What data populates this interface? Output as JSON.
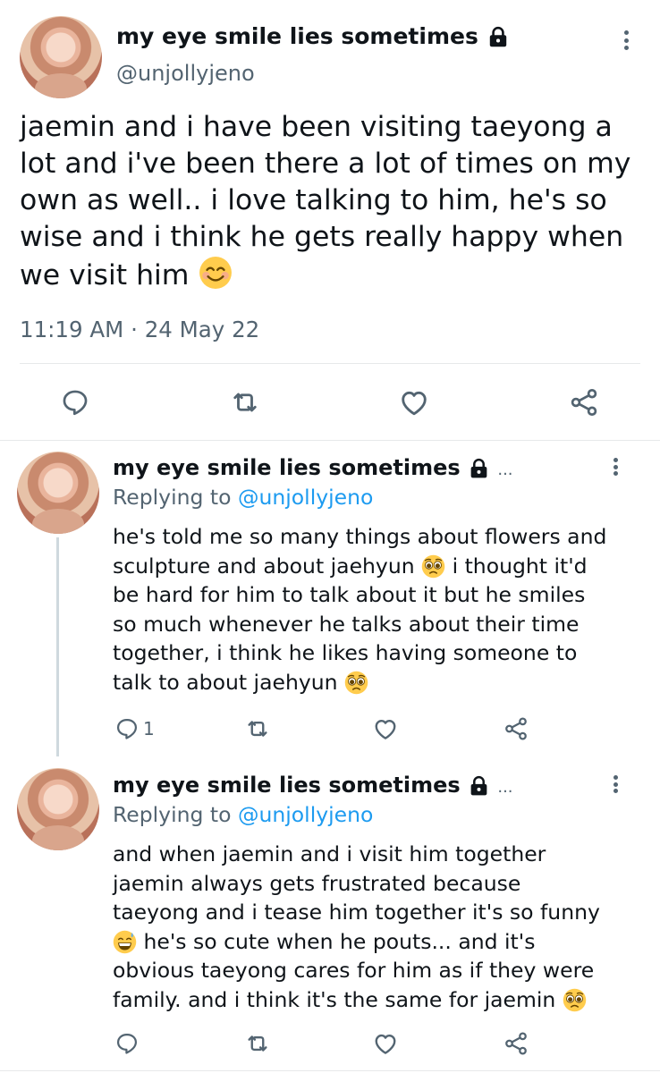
{
  "main_tweet": {
    "display_name": "my eye smile lies sometimes",
    "handle": "@unjollyjeno",
    "text": "jaemin and i have been visiting taeyong a lot and i've been there a lot of times on my own as well.. i love talking to him, he's so wise and i think he gets really happy when we visit him",
    "emoji": "smiling-face-emoji",
    "time": "11:19 AM",
    "separator": "·",
    "date": "24 May 22"
  },
  "replies": [
    {
      "display_name": "my eye smile lies sometimes",
      "ellipsis": "...",
      "replying_label": "Replying to",
      "replying_handle": "@unjollyjeno",
      "text_lines": [
        "he's told me so many things about flowers and",
        "sculpture and about jaehyun",
        "i thought it'd",
        "be hard for him to talk about it but he smiles",
        "so much whenever he talks about their time",
        "together, i think he likes having someone to",
        "talk to about jaehyun"
      ],
      "reply_count": "1"
    },
    {
      "display_name": "my eye smile lies sometimes",
      "ellipsis": "...",
      "replying_label": "Replying to",
      "replying_handle": "@unjollyjeno",
      "text_lines": [
        "and when jaemin and i visit him together",
        "jaemin always gets frustrated because",
        "taeyong and i tease him together it's so funny",
        "he's so cute when he pouts... and it's",
        "obvious taeyong cares for him as if they were",
        "family. and i think it's the same for jaemin"
      ],
      "reply_count": ""
    }
  ],
  "colors": {
    "accent": "#1d9bf0",
    "secondary_text": "#536471",
    "primary_text": "#0f1419",
    "divider": "#e7e9ea",
    "thread_line": "#cfd9de",
    "emoji_yellow": "#ffcc4d"
  },
  "icons": [
    "lock-icon",
    "more-icon",
    "reply-icon",
    "retweet-icon",
    "like-icon",
    "share-icon"
  ]
}
